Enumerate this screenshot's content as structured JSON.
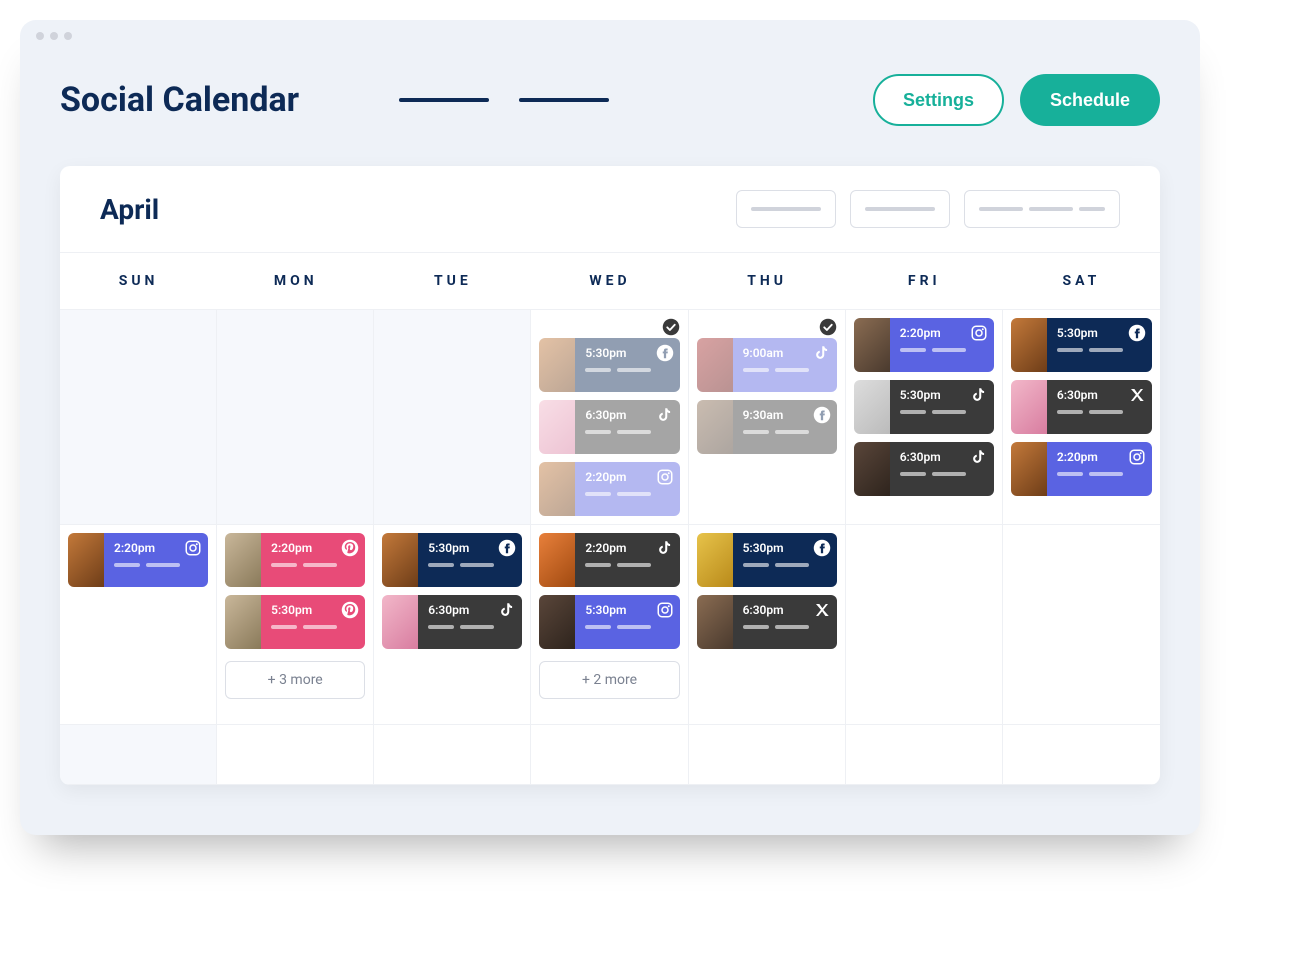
{
  "header": {
    "title": "Social Calendar",
    "settings_label": "Settings",
    "schedule_label": "Schedule"
  },
  "calendar": {
    "month_label": "April",
    "day_names": [
      "SUN",
      "MON",
      "TUE",
      "WED",
      "THU",
      "FRI",
      "SAT"
    ]
  },
  "weeks": [
    {
      "days": [
        {
          "blank": true
        },
        {
          "blank": true
        },
        {
          "blank": true
        },
        {
          "completed": true,
          "cards": [
            {
              "time": "5:30pm",
              "network": "facebook",
              "brand": "fb",
              "thumb": "burger",
              "faded": true
            },
            {
              "time": "6:30pm",
              "network": "tiktok",
              "brand": "tk",
              "thumb": "pink",
              "faded": true
            },
            {
              "time": "2:20pm",
              "network": "instagram",
              "brand": "ig",
              "thumb": "burger",
              "faded": true
            }
          ]
        },
        {
          "completed": true,
          "cards": [
            {
              "time": "9:00am",
              "network": "tiktok",
              "brand": "ig",
              "thumb": "red",
              "faded": true
            },
            {
              "time": "9:30am",
              "network": "facebook",
              "brand": "tk",
              "thumb": "person",
              "faded": true
            }
          ]
        },
        {
          "cards": [
            {
              "time": "2:20pm",
              "network": "instagram",
              "brand": "ig",
              "thumb": "person"
            },
            {
              "time": "5:30pm",
              "network": "tiktok",
              "brand": "tk",
              "thumb": "white"
            },
            {
              "time": "6:30pm",
              "network": "tiktok",
              "brand": "tk",
              "thumb": "dark"
            }
          ]
        },
        {
          "cards": [
            {
              "time": "5:30pm",
              "network": "facebook",
              "brand": "fb",
              "thumb": "burger"
            },
            {
              "time": "6:30pm",
              "network": "x",
              "brand": "x",
              "thumb": "pink"
            },
            {
              "time": "2:20pm",
              "network": "instagram",
              "brand": "ig",
              "thumb": "burger"
            }
          ]
        }
      ]
    },
    {
      "days": [
        {
          "cards": [
            {
              "time": "2:20pm",
              "network": "instagram",
              "brand": "ig",
              "thumb": "burger"
            }
          ]
        },
        {
          "cards": [
            {
              "time": "2:20pm",
              "network": "pinterest",
              "brand": "pn",
              "thumb": "watch"
            },
            {
              "time": "5:30pm",
              "network": "pinterest",
              "brand": "pn",
              "thumb": "watch"
            }
          ],
          "more_label": "+ 3 more"
        },
        {
          "cards": [
            {
              "time": "5:30pm",
              "network": "facebook",
              "brand": "fb",
              "thumb": "burger"
            },
            {
              "time": "6:30pm",
              "network": "tiktok",
              "brand": "tk",
              "thumb": "pink"
            }
          ]
        },
        {
          "cards": [
            {
              "time": "2:20pm",
              "network": "tiktok",
              "brand": "tk",
              "thumb": "orange"
            },
            {
              "time": "5:30pm",
              "network": "instagram",
              "brand": "ig",
              "thumb": "dark"
            }
          ],
          "more_label": "+ 2 more"
        },
        {
          "cards": [
            {
              "time": "5:30pm",
              "network": "facebook",
              "brand": "fb",
              "thumb": "yellow"
            },
            {
              "time": "6:30pm",
              "network": "x",
              "brand": "x",
              "thumb": "person"
            }
          ]
        },
        {
          "blank": false,
          "cards": []
        },
        {
          "blank": false,
          "cards": []
        }
      ]
    },
    {
      "short": true,
      "days": [
        {
          "blank": true
        },
        {
          "blank": false
        },
        {
          "blank": false
        },
        {
          "blank": false
        },
        {
          "blank": false
        },
        {
          "blank": false
        },
        {
          "blank": false
        }
      ]
    }
  ]
}
